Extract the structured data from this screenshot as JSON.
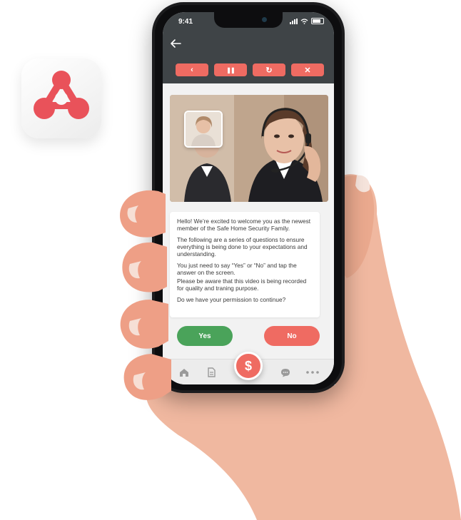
{
  "status_bar": {
    "time": "9:41"
  },
  "controls": {
    "back": "‹",
    "pause": "❚❚",
    "refresh": "↻",
    "close": "✕"
  },
  "message": {
    "p1": "Hello! We’re excited to welcome you as the newest member of the Safe Home Security Family.",
    "p2": "The following are a series of questions to ensure everything is being done to your expectations and understanding.",
    "p3": "You just need to say “Yes” or “No” and tap the answer on the screen.",
    "p4": "Please be aware that this video is being recorded for quality and traning purpose.",
    "p5": "Do we have your permission to continue?"
  },
  "answers": {
    "yes": "Yes",
    "no": "No"
  },
  "tabbar": {
    "fab": "$"
  },
  "colors": {
    "accent": "#ef6b62",
    "yes_green": "#4aa35a",
    "header_dark": "#3f4447"
  },
  "icons": [
    "app-logo-icon",
    "back-arrow-icon",
    "home-icon",
    "document-icon",
    "dollar-icon",
    "chat-icon",
    "more-icon"
  ]
}
